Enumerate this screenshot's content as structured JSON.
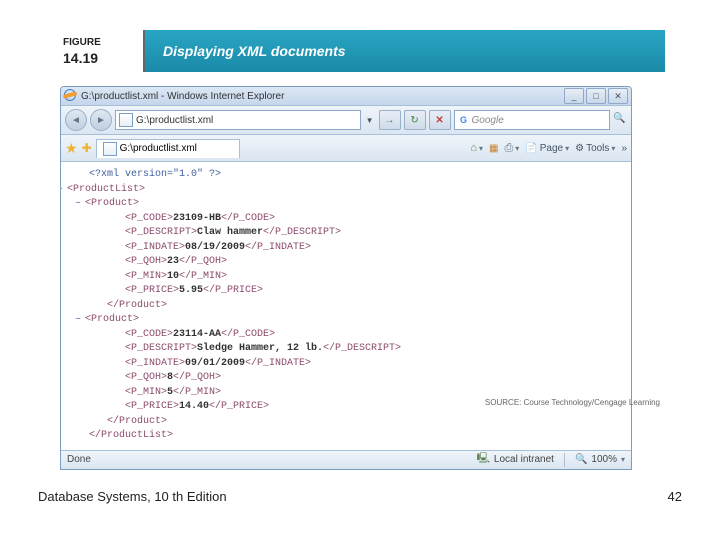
{
  "figure": {
    "label_word": "FIGURE",
    "label_num": "14.19",
    "title": "Displaying XML documents"
  },
  "ie": {
    "title": "G:\\productlist.xml - Windows Internet Explorer",
    "address": "G:\\productlist.xml",
    "search": "Google",
    "tab": "G:\\productlist.xml",
    "toolbar": {
      "page": "Page",
      "tools": "Tools"
    },
    "status": {
      "done": "Done",
      "zone": "Local intranet",
      "zoom": "100%"
    }
  },
  "xml": {
    "decl": "<?xml version=\"1.0\" ?>",
    "root_open": "<ProductList>",
    "root_close": "</ProductList>",
    "prod_open": "<Product>",
    "prod_close": "</Product>",
    "tags": {
      "code_o": "<P_CODE>",
      "code_c": "</P_CODE>",
      "desc_o": "<P_DESCRIPT>",
      "desc_c": "</P_DESCRIPT>",
      "indate_o": "<P_INDATE>",
      "indate_c": "</P_INDATE>",
      "qoh_o": "<P_QOH>",
      "qoh_c": "</P_QOH>",
      "min_o": "<P_MIN>",
      "min_c": "</P_MIN>",
      "price_o": "<P_PRICE>",
      "price_c": "</P_PRICE>"
    },
    "p1": {
      "code": "23109-HB",
      "desc": "Claw hammer",
      "indate": "08/19/2009",
      "qoh": "23",
      "min": "10",
      "price": "5.95"
    },
    "p2": {
      "code": "23114-AA",
      "desc": "Sledge Hammer, 12 lb.",
      "indate": "09/01/2009",
      "qoh": "8",
      "min": "5",
      "price": "14.40"
    }
  },
  "source": "SOURCE: Course Technology/Cengage Learning",
  "footer": {
    "left": "Database Systems, 10 th Edition",
    "right": "42"
  }
}
